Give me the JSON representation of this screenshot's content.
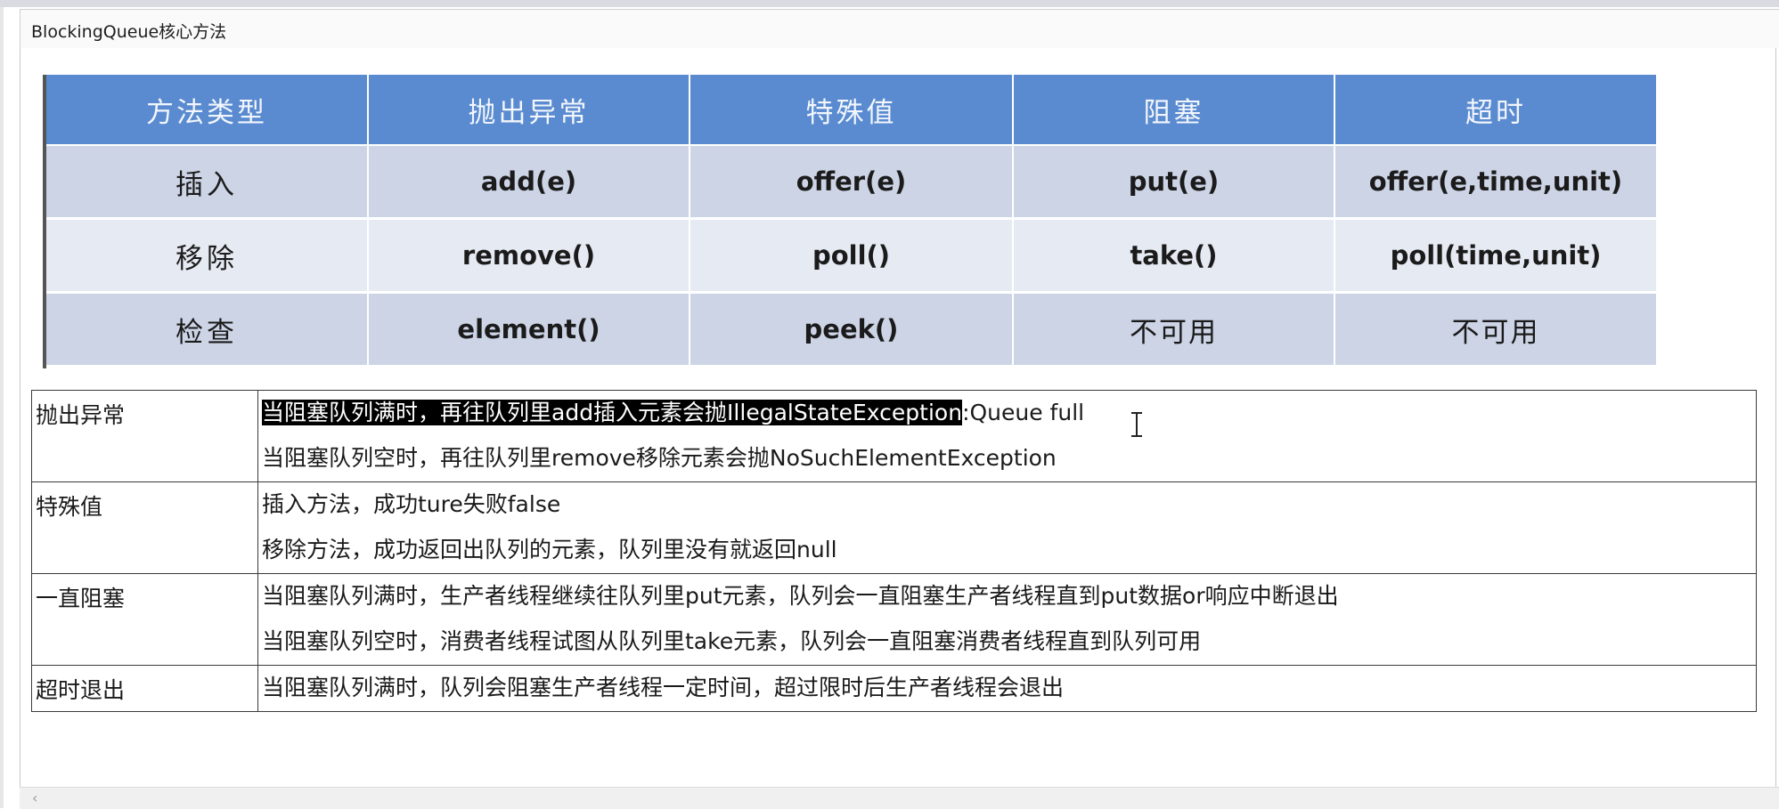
{
  "window": {
    "title": "BlockingQueue核心方法"
  },
  "methods_table": {
    "headers": [
      "方法类型",
      "抛出异常",
      "特殊值",
      "阻塞",
      "超时"
    ],
    "rows": [
      {
        "type": "插入",
        "throws": "add(e)",
        "special": "offer(e)",
        "blocks": "put(e)",
        "timeout": "offer(e,time,unit)"
      },
      {
        "type": "移除",
        "throws": "remove()",
        "special": "poll()",
        "blocks": "take()",
        "timeout": "poll(time,unit)"
      },
      {
        "type": "检查",
        "throws": "element()",
        "special": "peek()",
        "blocks": "不可用",
        "timeout": "不可用"
      }
    ]
  },
  "description_table": {
    "rows": [
      {
        "category": "抛出异常",
        "lines": [
          "当阻塞队列满时，再往队列里add插入元素会抛IllegalStateException",
          ":Queue full",
          "当阻塞队列空时，再往队列里remove移除元素会抛NoSuchElementException"
        ]
      },
      {
        "category": "特殊值",
        "lines": [
          "插入方法，成功ture失败false",
          "移除方法，成功返回出队列的元素，队列里没有就返回null"
        ]
      },
      {
        "category": "一直阻塞",
        "lines": [
          "当阻塞队列满时，生产者线程继续往队列里put元素，队列会一直阻塞生产者线程直到put数据or响应中断退出",
          "当阻塞队列空时，消费者线程试图从队列里take元素，队列会一直阻塞消费者线程直到队列可用"
        ]
      },
      {
        "category": "超时退出",
        "lines": [
          "当阻塞队列满时，队列会阻塞生产者线程一定时间，超过限时后生产者线程会退出"
        ]
      }
    ]
  }
}
